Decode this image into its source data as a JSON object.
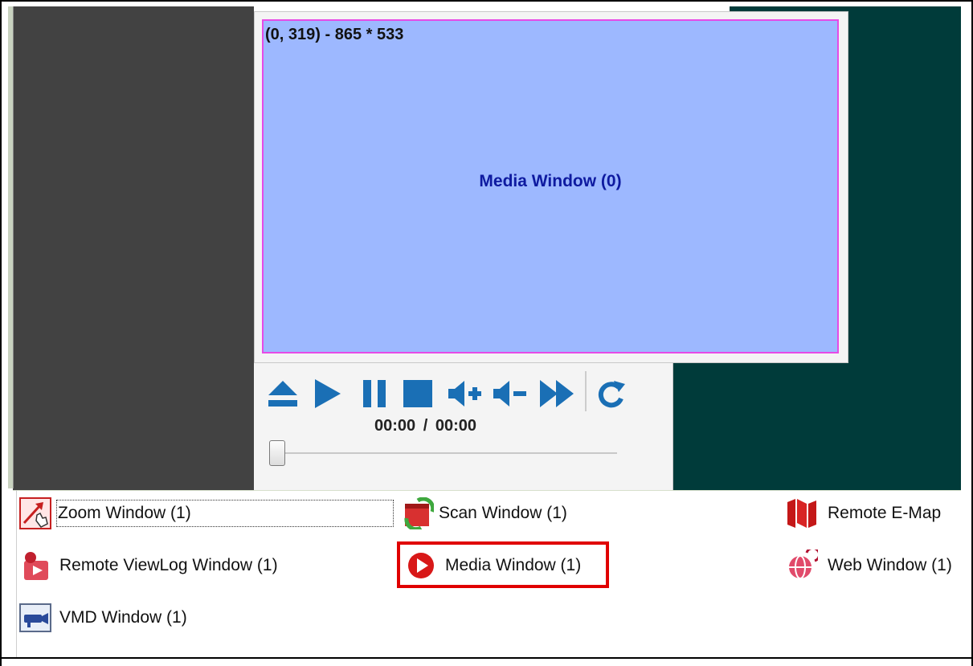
{
  "media_window": {
    "coords_text": "(0, 319) - 865 * 533",
    "center_label": "Media Window (0)"
  },
  "player": {
    "time_current": "00:00",
    "time_separator": "/",
    "time_total": "00:00",
    "seek_position": 0
  },
  "window_list": [
    {
      "label": "Zoom Window (1)",
      "icon": "zoom-window-icon"
    },
    {
      "label": "Scan Window (1)",
      "icon": "scan-window-icon"
    },
    {
      "label": "Remote E-Map",
      "icon": "emap-icon"
    },
    {
      "label": "Remote ViewLog Window (1)",
      "icon": "viewlog-icon"
    },
    {
      "label": "Media Window (1)",
      "icon": "media-window-icon"
    },
    {
      "label": "Web Window (1)",
      "icon": "web-window-icon"
    },
    {
      "label": "VMD Window (1)",
      "icon": "vmd-window-icon"
    }
  ],
  "colors": {
    "media_surface": "#9db8ff",
    "surface_border": "#e64be6",
    "accent_blue": "#1a6fb5",
    "highlight_red": "#e00000",
    "teal_bg": "#003b3a",
    "dark_bg": "#424242"
  }
}
